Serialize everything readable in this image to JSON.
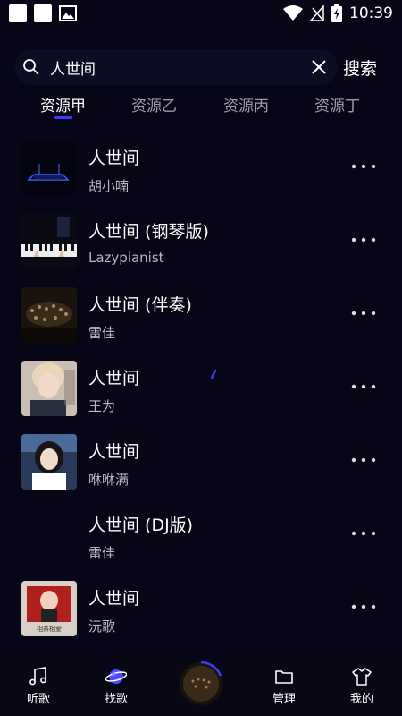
{
  "status_bar": {
    "time": "10:39"
  },
  "search": {
    "query": "人世间",
    "submit_label": "搜索"
  },
  "tabs": [
    {
      "label": "资源甲",
      "active": true
    },
    {
      "label": "资源乙",
      "active": false
    },
    {
      "label": "资源丙",
      "active": false
    },
    {
      "label": "资源丁",
      "active": false
    }
  ],
  "songs": [
    {
      "title": "人世间",
      "artist": "胡小喃"
    },
    {
      "title": "人世间 (钢琴版)",
      "artist": "Lazypianist"
    },
    {
      "title": "人世间 (伴奏)",
      "artist": "雷佳"
    },
    {
      "title": "人世间",
      "artist": "王为"
    },
    {
      "title": "人世间",
      "artist": "咻咻满"
    },
    {
      "title": "人世间 (DJ版)",
      "artist": "雷佳"
    },
    {
      "title": "人世间",
      "artist": "沅歌",
      "cover_text": "相亲相爱"
    }
  ],
  "nav": [
    {
      "label": "听歌",
      "icon": "music-note-icon"
    },
    {
      "label": "找歌",
      "icon": "planet-icon"
    },
    {
      "label": "管理",
      "icon": "folder-icon"
    },
    {
      "label": "我的",
      "icon": "shirt-icon"
    }
  ],
  "colors": {
    "background": "#060616",
    "accent": "#3b3bff",
    "text": "#ffffff",
    "subtext": "#b8b8c4"
  }
}
